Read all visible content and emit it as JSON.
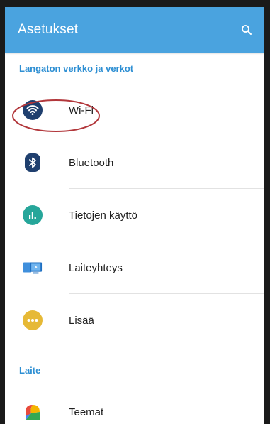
{
  "appbar": {
    "title": "Asetukset",
    "search_icon": "search-icon"
  },
  "sections": [
    {
      "header": "Langaton verkko ja verkot",
      "items": [
        {
          "label": "Wi-Fi",
          "icon": "wifi-icon",
          "color": "#1f3f6e"
        },
        {
          "label": "Bluetooth",
          "icon": "bluetooth-icon",
          "color": "#1f3f6e"
        },
        {
          "label": "Tietojen käyttö",
          "icon": "data-usage-icon",
          "color": "#26a69a"
        },
        {
          "label": "Laiteyhteys",
          "icon": "device-connection-icon",
          "color": "#3f8fdc"
        },
        {
          "label": "Lisää",
          "icon": "more-icon",
          "color": "#e6b936"
        }
      ]
    },
    {
      "header": "Laite",
      "items": [
        {
          "label": "Teemat",
          "icon": "themes-icon"
        }
      ]
    }
  ],
  "colors": {
    "appbar": "#4aa3df",
    "section_header": "#2e8fd3",
    "annotation_ring": "#b2373b"
  }
}
